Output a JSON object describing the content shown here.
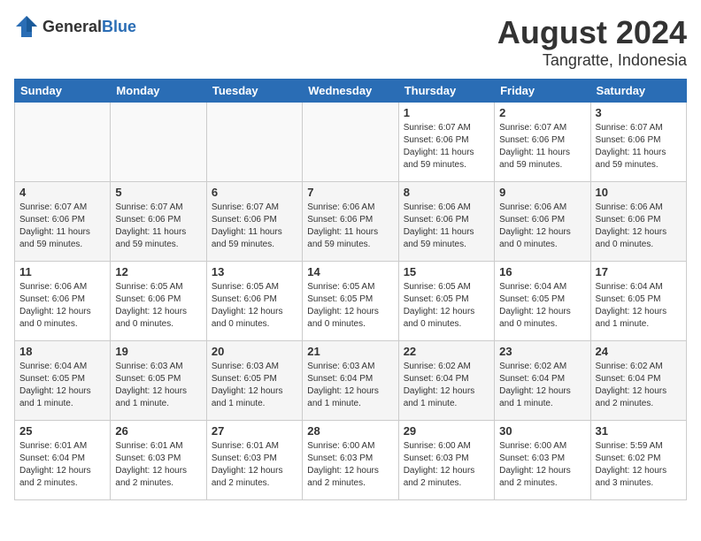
{
  "header": {
    "logo_general": "General",
    "logo_blue": "Blue",
    "title": "August 2024",
    "subtitle": "Tangratte, Indonesia"
  },
  "weekdays": [
    "Sunday",
    "Monday",
    "Tuesday",
    "Wednesday",
    "Thursday",
    "Friday",
    "Saturday"
  ],
  "weeks": [
    [
      {
        "day": "",
        "info": ""
      },
      {
        "day": "",
        "info": ""
      },
      {
        "day": "",
        "info": ""
      },
      {
        "day": "",
        "info": ""
      },
      {
        "day": "1",
        "info": "Sunrise: 6:07 AM\nSunset: 6:06 PM\nDaylight: 11 hours and 59 minutes."
      },
      {
        "day": "2",
        "info": "Sunrise: 6:07 AM\nSunset: 6:06 PM\nDaylight: 11 hours and 59 minutes."
      },
      {
        "day": "3",
        "info": "Sunrise: 6:07 AM\nSunset: 6:06 PM\nDaylight: 11 hours and 59 minutes."
      }
    ],
    [
      {
        "day": "4",
        "info": "Sunrise: 6:07 AM\nSunset: 6:06 PM\nDaylight: 11 hours and 59 minutes."
      },
      {
        "day": "5",
        "info": "Sunrise: 6:07 AM\nSunset: 6:06 PM\nDaylight: 11 hours and 59 minutes."
      },
      {
        "day": "6",
        "info": "Sunrise: 6:07 AM\nSunset: 6:06 PM\nDaylight: 11 hours and 59 minutes."
      },
      {
        "day": "7",
        "info": "Sunrise: 6:06 AM\nSunset: 6:06 PM\nDaylight: 11 hours and 59 minutes."
      },
      {
        "day": "8",
        "info": "Sunrise: 6:06 AM\nSunset: 6:06 PM\nDaylight: 11 hours and 59 minutes."
      },
      {
        "day": "9",
        "info": "Sunrise: 6:06 AM\nSunset: 6:06 PM\nDaylight: 12 hours and 0 minutes."
      },
      {
        "day": "10",
        "info": "Sunrise: 6:06 AM\nSunset: 6:06 PM\nDaylight: 12 hours and 0 minutes."
      }
    ],
    [
      {
        "day": "11",
        "info": "Sunrise: 6:06 AM\nSunset: 6:06 PM\nDaylight: 12 hours and 0 minutes."
      },
      {
        "day": "12",
        "info": "Sunrise: 6:05 AM\nSunset: 6:06 PM\nDaylight: 12 hours and 0 minutes."
      },
      {
        "day": "13",
        "info": "Sunrise: 6:05 AM\nSunset: 6:06 PM\nDaylight: 12 hours and 0 minutes."
      },
      {
        "day": "14",
        "info": "Sunrise: 6:05 AM\nSunset: 6:05 PM\nDaylight: 12 hours and 0 minutes."
      },
      {
        "day": "15",
        "info": "Sunrise: 6:05 AM\nSunset: 6:05 PM\nDaylight: 12 hours and 0 minutes."
      },
      {
        "day": "16",
        "info": "Sunrise: 6:04 AM\nSunset: 6:05 PM\nDaylight: 12 hours and 0 minutes."
      },
      {
        "day": "17",
        "info": "Sunrise: 6:04 AM\nSunset: 6:05 PM\nDaylight: 12 hours and 1 minute."
      }
    ],
    [
      {
        "day": "18",
        "info": "Sunrise: 6:04 AM\nSunset: 6:05 PM\nDaylight: 12 hours and 1 minute."
      },
      {
        "day": "19",
        "info": "Sunrise: 6:03 AM\nSunset: 6:05 PM\nDaylight: 12 hours and 1 minute."
      },
      {
        "day": "20",
        "info": "Sunrise: 6:03 AM\nSunset: 6:05 PM\nDaylight: 12 hours and 1 minute."
      },
      {
        "day": "21",
        "info": "Sunrise: 6:03 AM\nSunset: 6:04 PM\nDaylight: 12 hours and 1 minute."
      },
      {
        "day": "22",
        "info": "Sunrise: 6:02 AM\nSunset: 6:04 PM\nDaylight: 12 hours and 1 minute."
      },
      {
        "day": "23",
        "info": "Sunrise: 6:02 AM\nSunset: 6:04 PM\nDaylight: 12 hours and 1 minute."
      },
      {
        "day": "24",
        "info": "Sunrise: 6:02 AM\nSunset: 6:04 PM\nDaylight: 12 hours and 2 minutes."
      }
    ],
    [
      {
        "day": "25",
        "info": "Sunrise: 6:01 AM\nSunset: 6:04 PM\nDaylight: 12 hours and 2 minutes."
      },
      {
        "day": "26",
        "info": "Sunrise: 6:01 AM\nSunset: 6:03 PM\nDaylight: 12 hours and 2 minutes."
      },
      {
        "day": "27",
        "info": "Sunrise: 6:01 AM\nSunset: 6:03 PM\nDaylight: 12 hours and 2 minutes."
      },
      {
        "day": "28",
        "info": "Sunrise: 6:00 AM\nSunset: 6:03 PM\nDaylight: 12 hours and 2 minutes."
      },
      {
        "day": "29",
        "info": "Sunrise: 6:00 AM\nSunset: 6:03 PM\nDaylight: 12 hours and 2 minutes."
      },
      {
        "day": "30",
        "info": "Sunrise: 6:00 AM\nSunset: 6:03 PM\nDaylight: 12 hours and 2 minutes."
      },
      {
        "day": "31",
        "info": "Sunrise: 5:59 AM\nSunset: 6:02 PM\nDaylight: 12 hours and 3 minutes."
      }
    ]
  ]
}
